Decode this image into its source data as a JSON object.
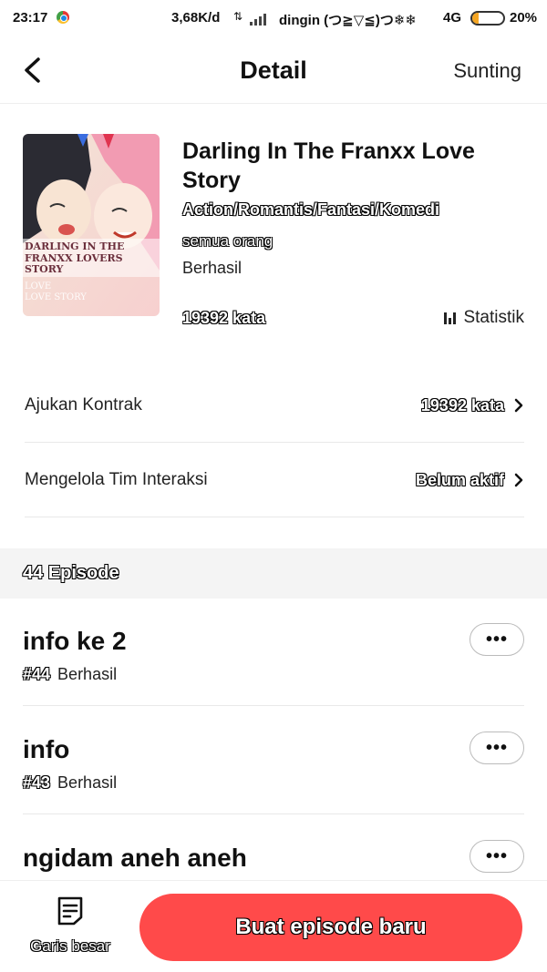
{
  "status_bar": {
    "time": "23:17",
    "speed": "3,68K/d",
    "arrows": "⇅",
    "carrier": "dingin (つ≧▽≦)つ❄❄",
    "network": "4G",
    "battery": "20%",
    "battery_level": 0.2
  },
  "header": {
    "title": "Detail",
    "edit_label": "Sunting"
  },
  "book": {
    "title": "Darling In The Franxx Love Story",
    "genres": "Action/Romantis/Fantasi/Komedi",
    "audience": "semua orang",
    "status": "Berhasil",
    "word_count": "19392 kata",
    "stats_label": "Statistik",
    "cover_text": [
      "DARLING IN THE",
      "FRANXX LOVERS",
      "STORY",
      "LOVE",
      "LOVE STORY"
    ]
  },
  "rows": [
    {
      "label": "Ajukan Kontrak",
      "value": "19392 kata"
    },
    {
      "label": "Mengelola Tim Interaksi",
      "value": "Belum aktif"
    }
  ],
  "episodes_section": {
    "title": "44 Episode"
  },
  "episodes": [
    {
      "title": "info ke 2",
      "number": "#44",
      "status": "Berhasil",
      "more": "•••"
    },
    {
      "title": "info",
      "number": "#43",
      "status": "Berhasil",
      "more": "•••"
    },
    {
      "title": "ngidam aneh aneh",
      "number": "",
      "status": "",
      "more": "•••"
    }
  ],
  "bottom": {
    "outline_label": "Garis besar",
    "new_episode_label": "Buat episode baru"
  },
  "colors": {
    "accent": "#ff4a4a",
    "battery": "#f5a623"
  }
}
